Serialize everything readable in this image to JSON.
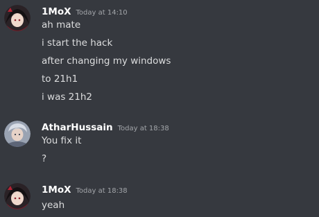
{
  "messages": [
    {
      "author": "1MoX",
      "timestamp": "Today at 14:10",
      "avatar_icon": "anime-character-avatar-icon",
      "lines": [
        "ah mate",
        "i start the hack",
        "after changing my windows",
        "to 21h1",
        "i was 21h2"
      ]
    },
    {
      "author": "AtharHussain",
      "timestamp": "Today at 18:38",
      "avatar_icon": "profile-photo-avatar-icon",
      "lines": [
        "You fix it",
        "?"
      ]
    },
    {
      "author": "1MoX",
      "timestamp": "Today at 18:38",
      "avatar_icon": "anime-character-avatar-icon",
      "lines": [
        "yeah"
      ]
    }
  ],
  "colors": {
    "background": "#36393f",
    "username": "#ffffff",
    "message_text": "#dcddde",
    "timestamp": "#a3a6aa"
  }
}
